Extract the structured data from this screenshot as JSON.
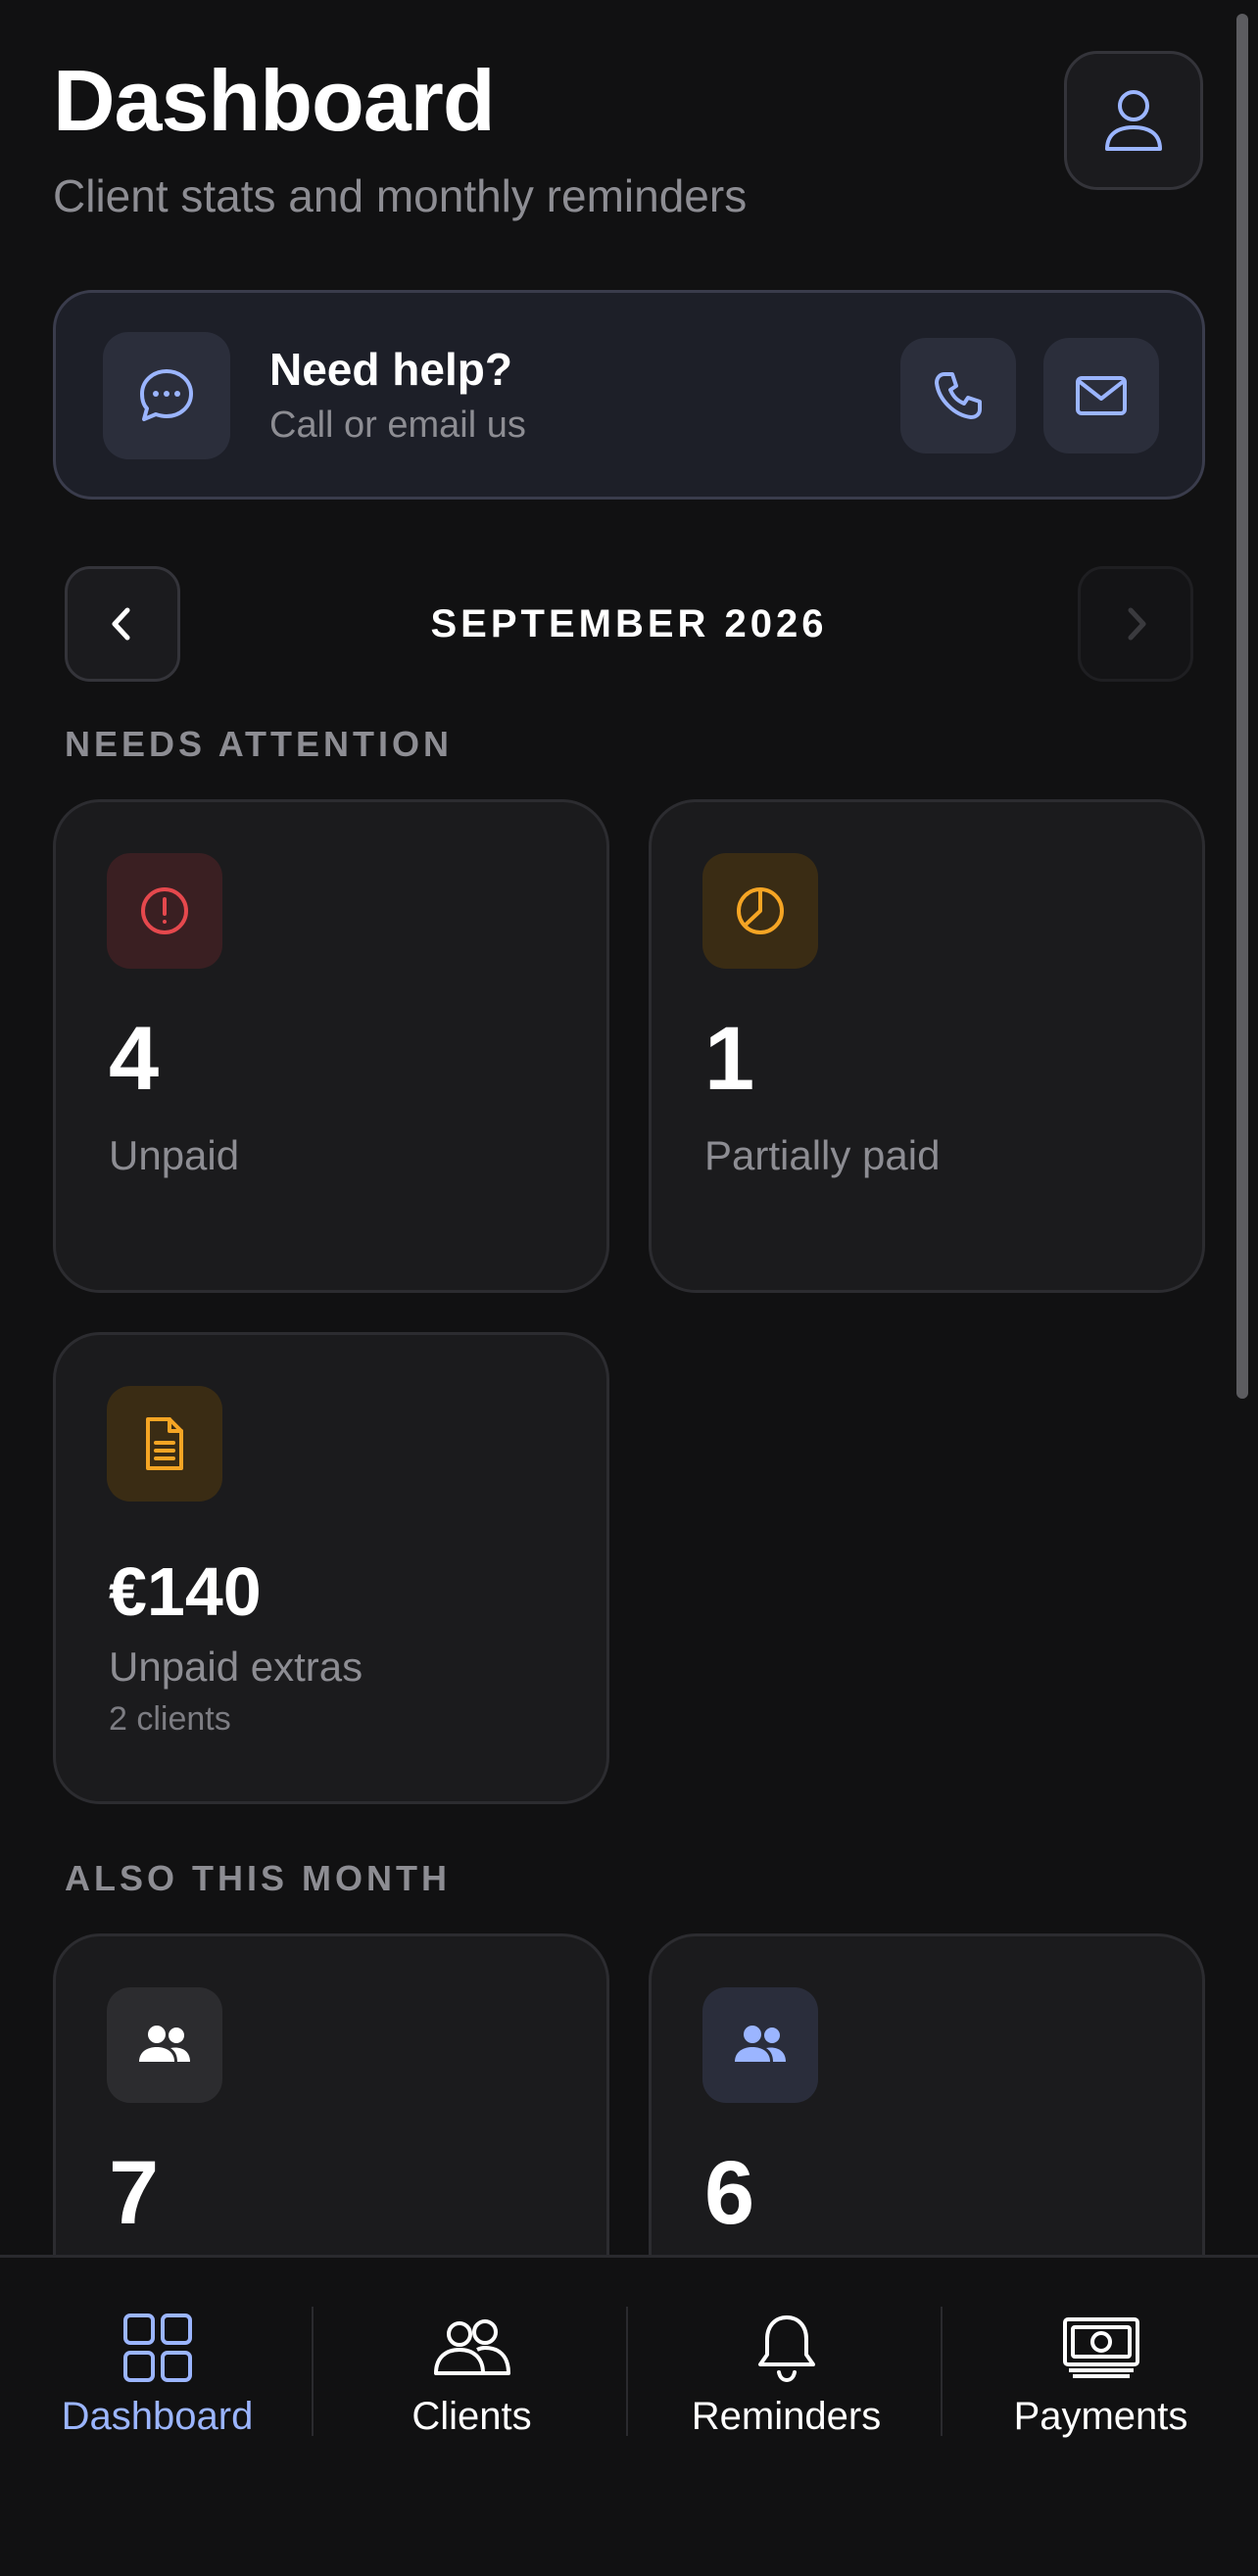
{
  "header": {
    "title": "Dashboard",
    "subtitle": "Client stats and monthly reminders",
    "profile_icon": "user-icon"
  },
  "help": {
    "title": "Need help?",
    "subtitle": "Call or email us",
    "icon": "chat-bubble-icon",
    "actions": [
      "phone-icon",
      "mail-icon"
    ]
  },
  "month_nav": {
    "label": "SEPTEMBER 2026",
    "prev_enabled": true,
    "next_enabled": false
  },
  "sections": {
    "needs_attention": "NEEDS ATTENTION",
    "also_this_month": "ALSO THIS MONTH"
  },
  "needs_attention": [
    {
      "value": "4",
      "label": "Unpaid",
      "icon": "alert-circle-icon",
      "accent": "#e5484d"
    },
    {
      "value": "1",
      "label": "Partially paid",
      "icon": "pie-chart-icon",
      "accent": "#f5a524"
    },
    {
      "value": "€140",
      "label": "Unpaid extras",
      "sub": "2 clients",
      "icon": "document-icon",
      "accent": "#f5a524"
    }
  ],
  "also_this_month": [
    {
      "value": "7",
      "icon": "users-icon",
      "accent": "#ffffff"
    },
    {
      "value": "6",
      "icon": "users-icon",
      "accent": "#9bb5ff"
    }
  ],
  "tabs": [
    {
      "label": "Dashboard",
      "icon": "grid-icon",
      "active": true
    },
    {
      "label": "Clients",
      "icon": "users-outline-icon",
      "active": false
    },
    {
      "label": "Reminders",
      "icon": "bell-icon",
      "active": false
    },
    {
      "label": "Payments",
      "icon": "banknote-icon",
      "active": false
    }
  ],
  "colors": {
    "background": "#111112",
    "accent": "#9bb5ff",
    "card": "#1b1b1d",
    "muted_text": "#8d8d93"
  }
}
